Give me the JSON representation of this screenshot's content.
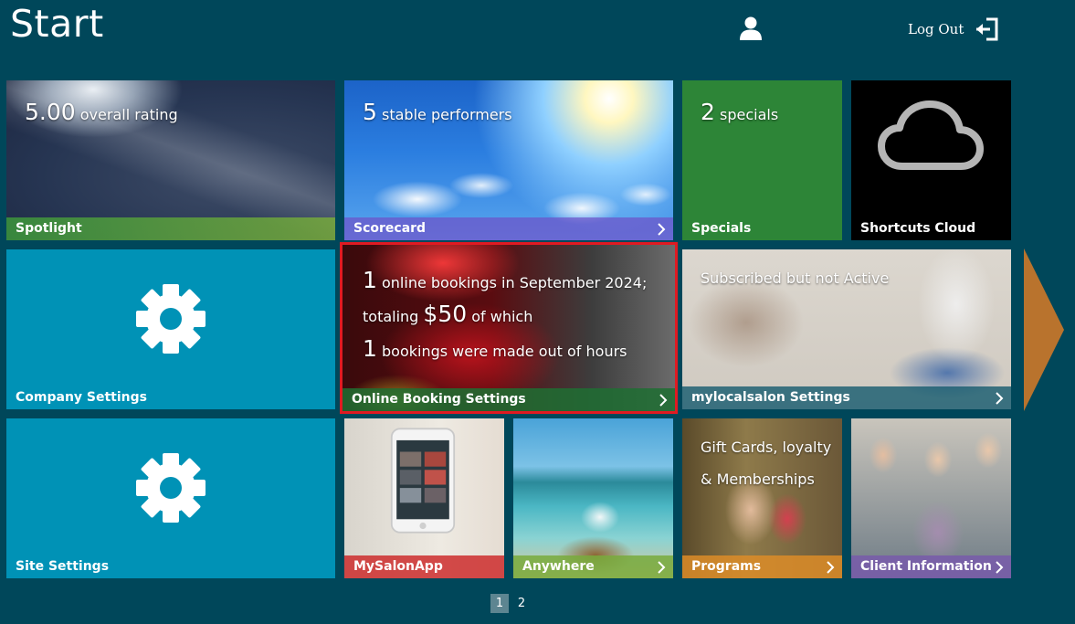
{
  "header": {
    "title": "Start",
    "logout_label": "Log Out"
  },
  "tiles": {
    "spotlight": {
      "value": "5.00",
      "text": "overall rating",
      "label": "Spotlight"
    },
    "scorecard": {
      "value": "5",
      "text": "stable performers",
      "label": "Scorecard"
    },
    "specials": {
      "value": "2",
      "text": "specials",
      "label": "Specials"
    },
    "shortcuts": {
      "label": "Shortcuts Cloud"
    },
    "company_settings": {
      "label": "Company Settings"
    },
    "online_booking": {
      "line1_value": "1",
      "line1_text": "online bookings in September 2024;",
      "line2_prefix": "totaling",
      "line2_value": "$50",
      "line2_suffix": "of which",
      "line3_value": "1",
      "line3_text": "bookings were made out of hours",
      "label": "Online Booking Settings"
    },
    "mylocalsalon": {
      "status": "Subscribed but not Active",
      "label": "mylocalsalon Settings"
    },
    "site_settings": {
      "label": "Site Settings"
    },
    "mysalonapp": {
      "label": "MySalonApp"
    },
    "anywhere": {
      "label": "Anywhere"
    },
    "programs": {
      "line1": "Gift Cards, loyalty",
      "line2": "& Memberships",
      "label": "Programs"
    },
    "client_info": {
      "label": "Client Information"
    }
  },
  "pager": {
    "pages": [
      "1",
      "2"
    ],
    "current": "1"
  },
  "colors": {
    "background": "#00475a",
    "teal_tile": "#0092b6",
    "green_tile": "#2d8537",
    "highlight_border": "#e01a22",
    "next_arrow": "#b9732d"
  }
}
